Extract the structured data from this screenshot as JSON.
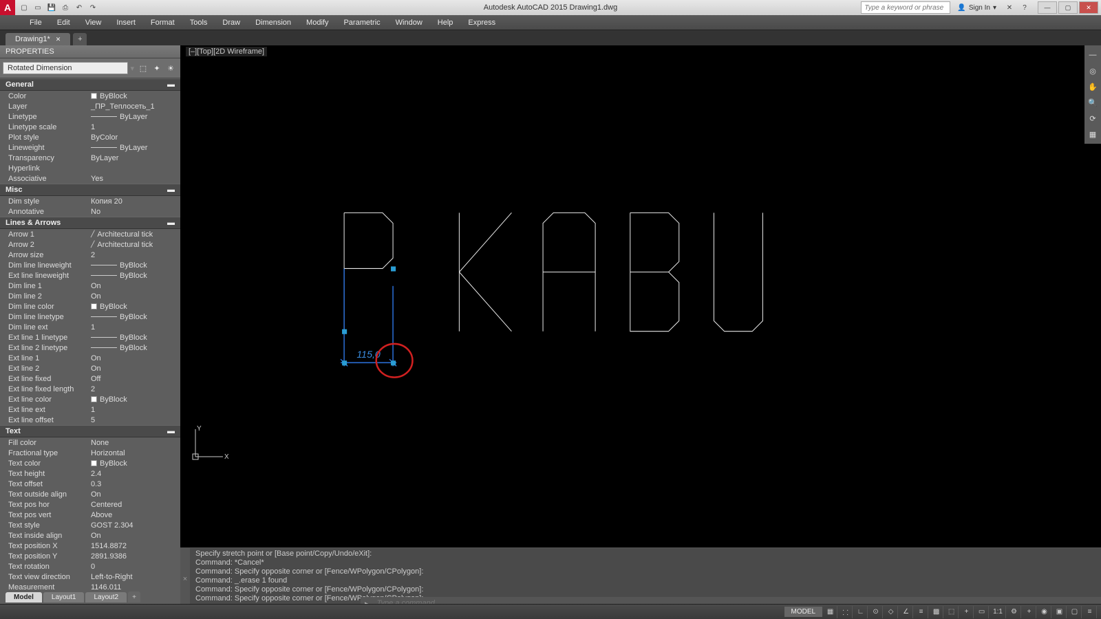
{
  "app": {
    "title": "Autodesk AutoCAD 2015   Drawing1.dwg"
  },
  "search": {
    "placeholder": "Type a keyword or phrase"
  },
  "signin": {
    "label": "Sign In"
  },
  "menu": [
    "File",
    "Edit",
    "View",
    "Insert",
    "Format",
    "Tools",
    "Draw",
    "Dimension",
    "Modify",
    "Parametric",
    "Window",
    "Help",
    "Express"
  ],
  "filetab": {
    "name": "Drawing1*"
  },
  "viewport": {
    "label": "[–][Top][2D Wireframe]"
  },
  "props": {
    "title": "PROPERTIES",
    "selection": "Rotated Dimension",
    "sections": {
      "general": {
        "title": "General",
        "rows": [
          {
            "l": "Color",
            "v": "ByBlock",
            "swatch": true
          },
          {
            "l": "Layer",
            "v": "_ПР_Теплосеть_1"
          },
          {
            "l": "Linetype",
            "v": "ByLayer",
            "line": true
          },
          {
            "l": "Linetype scale",
            "v": "1"
          },
          {
            "l": "Plot style",
            "v": "ByColor"
          },
          {
            "l": "Lineweight",
            "v": "ByLayer",
            "line": true
          },
          {
            "l": "Transparency",
            "v": "ByLayer"
          },
          {
            "l": "Hyperlink",
            "v": ""
          },
          {
            "l": "Associative",
            "v": "Yes"
          }
        ]
      },
      "misc": {
        "title": "Misc",
        "rows": [
          {
            "l": "Dim style",
            "v": "Копия 20"
          },
          {
            "l": "Annotative",
            "v": "No"
          }
        ]
      },
      "lines": {
        "title": "Lines & Arrows",
        "rows": [
          {
            "l": "Arrow 1",
            "v": "Architectural tick",
            "tick": true
          },
          {
            "l": "Arrow 2",
            "v": "Architectural tick",
            "tick": true
          },
          {
            "l": "Arrow size",
            "v": "2"
          },
          {
            "l": "Dim line lineweight",
            "v": "ByBlock",
            "line": true
          },
          {
            "l": "Ext line lineweight",
            "v": "ByBlock",
            "line": true
          },
          {
            "l": "Dim line 1",
            "v": "On"
          },
          {
            "l": "Dim line 2",
            "v": "On"
          },
          {
            "l": "Dim line color",
            "v": "ByBlock",
            "swatch": true
          },
          {
            "l": "Dim line linetype",
            "v": "ByBlock",
            "line": true
          },
          {
            "l": "Dim line ext",
            "v": "1"
          },
          {
            "l": "Ext line 1 linetype",
            "v": "ByBlock",
            "line": true
          },
          {
            "l": "Ext line 2 linetype",
            "v": "ByBlock",
            "line": true
          },
          {
            "l": "Ext line 1",
            "v": "On"
          },
          {
            "l": "Ext line 2",
            "v": "On"
          },
          {
            "l": "Ext line fixed",
            "v": "Off"
          },
          {
            "l": "Ext line fixed length",
            "v": "2"
          },
          {
            "l": "Ext line color",
            "v": "ByBlock",
            "swatch": true
          },
          {
            "l": "Ext line ext",
            "v": "1"
          },
          {
            "l": "Ext line offset",
            "v": "5"
          }
        ]
      },
      "text": {
        "title": "Text",
        "rows": [
          {
            "l": "Fill color",
            "v": "None"
          },
          {
            "l": "Fractional type",
            "v": "Horizontal"
          },
          {
            "l": "Text color",
            "v": "ByBlock",
            "swatch": true
          },
          {
            "l": "Text height",
            "v": "2.4"
          },
          {
            "l": "Text offset",
            "v": "0.3"
          },
          {
            "l": "Text outside align",
            "v": "On"
          },
          {
            "l": "Text pos hor",
            "v": "Centered"
          },
          {
            "l": "Text pos vert",
            "v": "Above"
          },
          {
            "l": "Text style",
            "v": "GOST 2.304"
          },
          {
            "l": "Text inside align",
            "v": "On"
          },
          {
            "l": "Text position X",
            "v": "1514.8872"
          },
          {
            "l": "Text position Y",
            "v": "2891.9386"
          },
          {
            "l": "Text rotation",
            "v": "0"
          },
          {
            "l": "Text view direction",
            "v": "Left-to-Right"
          },
          {
            "l": "Measurement",
            "v": "1146.011"
          }
        ]
      }
    }
  },
  "dimension": {
    "text": "115,0"
  },
  "cmd": {
    "lines": [
      "Specify stretch point or [Base point/Copy/Undo/eXit]:",
      "Command: *Cancel*",
      "Command: Specify opposite corner or [Fence/WPolygon/CPolygon]:",
      "Command: _.erase 1 found",
      "Command: Specify opposite corner or [Fence/WPolygon/CPolygon]:",
      "Command: Specify opposite corner or [Fence/WPolygon/CPolygon]:"
    ],
    "placeholder": "Type a command"
  },
  "layouts": {
    "active": "Model",
    "tabs": [
      "Layout1",
      "Layout2"
    ]
  },
  "status": {
    "model": "MODEL",
    "scale": "1:1"
  },
  "ucs": {
    "x": "X",
    "y": "Y"
  }
}
